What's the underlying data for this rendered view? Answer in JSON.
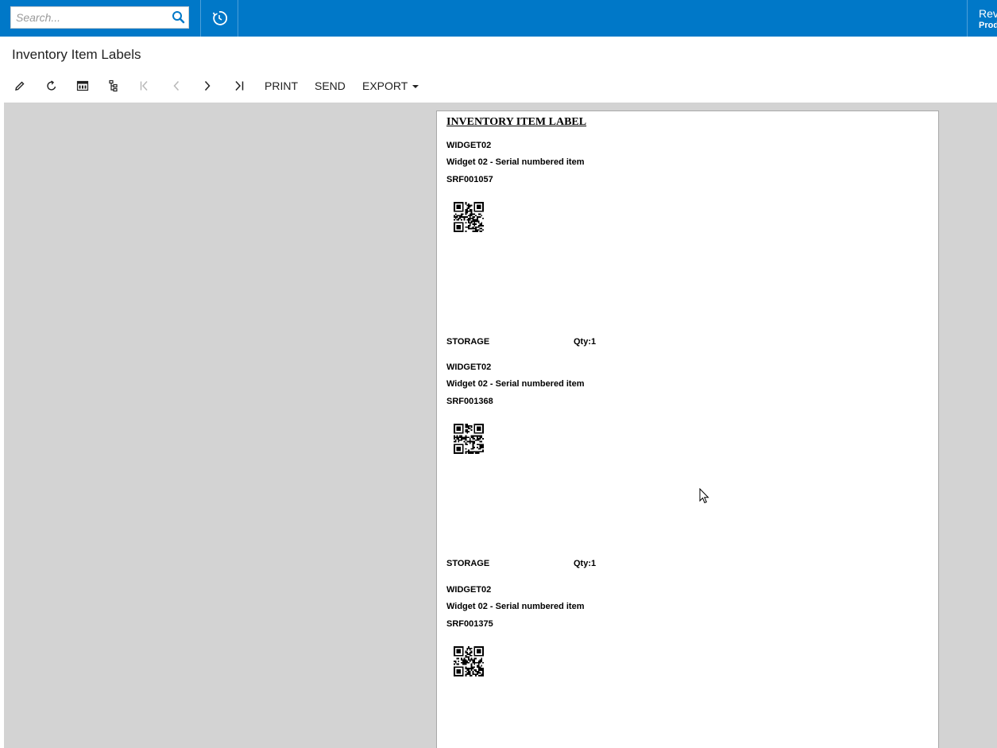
{
  "topbar": {
    "search_placeholder": "Search...",
    "right_title": "Rev",
    "right_subtitle": "Prod"
  },
  "page": {
    "title": "Inventory Item Labels"
  },
  "toolbar": {
    "icons": [
      "edit-icon",
      "refresh-icon",
      "pdf-icon",
      "tree-icon",
      "first-page-icon",
      "previous-page-icon",
      "next-page-icon",
      "last-page-icon"
    ],
    "print_label": "PRINT",
    "send_label": "SEND",
    "export_label": "EXPORT"
  },
  "report": {
    "title": "INVENTORY ITEM LABEL",
    "labels": [
      {
        "item_id": "WIDGET02",
        "description": "Widget 02 - Serial numbered item",
        "serial": "SRF001057",
        "location": "STORAGE",
        "qty": "Qty:1"
      },
      {
        "item_id": "WIDGET02",
        "description": "Widget 02 - Serial numbered item",
        "serial": "SRF001368",
        "location": "STORAGE",
        "qty": "Qty:1"
      },
      {
        "item_id": "WIDGET02",
        "description": "Widget 02 - Serial numbered item",
        "serial": "SRF001375"
      }
    ]
  },
  "colors": {
    "topbar": "#0078c8",
    "viewer_background": "#d3d3d3"
  }
}
